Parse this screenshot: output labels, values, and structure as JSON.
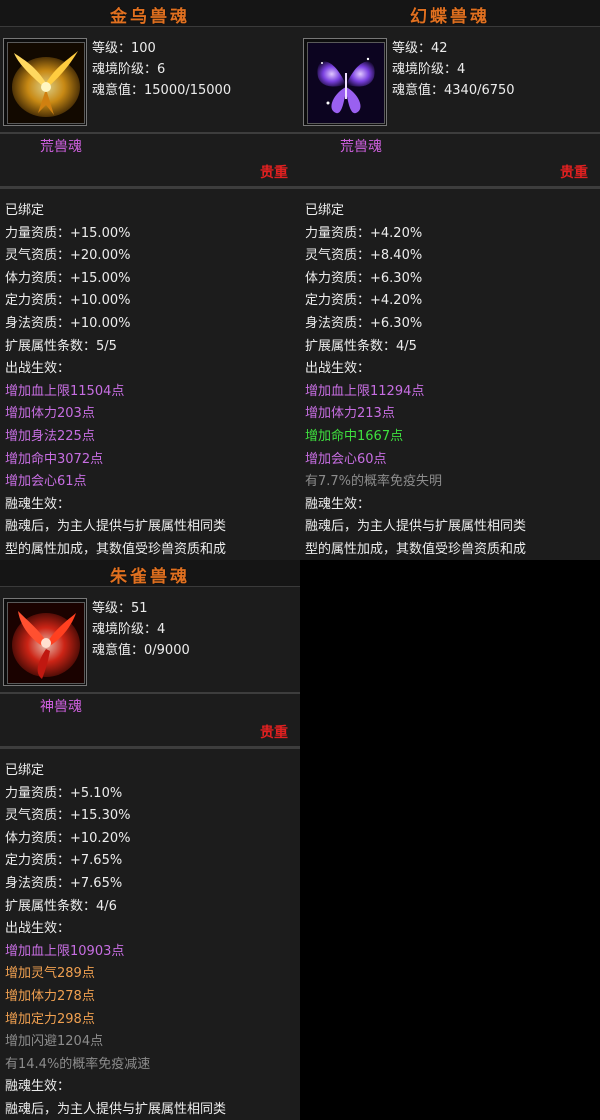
{
  "cards": [
    {
      "title": "金乌兽魂",
      "level_line": "等级：100",
      "realm_line": "魂境阶级：6",
      "soul_line": "魂意值：15000/15000",
      "grade": "荒兽魂",
      "rank": "贵重",
      "bound": "已绑定",
      "attrs": [
        "力量资质：+15.00%",
        "灵气资质：+20.00%",
        "体力资质：+15.00%",
        "定力资质：+10.00%",
        "身法资质：+10.00%"
      ],
      "ext": "扩展属性条数：5/5",
      "battle_label": "出战生效：",
      "effects": [
        "增加血上限11504点",
        "增加体力203点",
        "增加身法225点",
        "增加命中3072点",
        "增加会心61点"
      ],
      "fusion_label": "融魂生效：",
      "fusion_text": [
        "融魂后，为主人提供与扩展属性相同类",
        "型的属性加成，其数值受珍兽资质和成"
      ]
    },
    {
      "title": "幻蝶兽魂",
      "level_line": "等级：42",
      "realm_line": "魂境阶级：4",
      "soul_line": "魂意值：4340/6750",
      "grade": "荒兽魂",
      "rank": "贵重",
      "bound": "已绑定",
      "attrs": [
        "力量资质：+4.20%",
        "灵气资质：+8.40%",
        "体力资质：+6.30%",
        "定力资质：+4.20%",
        "身法资质：+6.30%"
      ],
      "ext": "扩展属性条数：4/5",
      "battle_label": "出战生效：",
      "effects": [
        "增加血上限11294点",
        "增加体力213点",
        "增加命中1667点",
        "增加会心60点",
        "有7.7%的概率免疫失明"
      ],
      "fusion_label": "融魂生效：",
      "fusion_text": [
        "融魂后，为主人提供与扩展属性相同类",
        "型的属性加成，其数值受珍兽资质和成"
      ]
    },
    {
      "title": "朱雀兽魂",
      "level_line": "等级：51",
      "realm_line": "魂境阶级：4",
      "soul_line": "魂意值：0/9000",
      "grade": "神兽魂",
      "rank": "贵重",
      "bound": "已绑定",
      "attrs": [
        "力量资质：+5.10%",
        "灵气资质：+15.30%",
        "体力资质：+10.20%",
        "定力资质：+7.65%",
        "身法资质：+7.65%"
      ],
      "ext": "扩展属性条数：4/6",
      "battle_label": "出战生效：",
      "effects": [
        "增加血上限10903点",
        "增加灵气289点",
        "增加体力278点",
        "增加定力298点",
        "增加闪避1204点",
        "有14.4%的概率免疫减速"
      ],
      "fusion_label": "融魂生效：",
      "fusion_text": [
        "融魂后，为主人提供与扩展属性相同类"
      ]
    }
  ],
  "colors": {
    "title": "#e07020",
    "grade": "#d060e0",
    "rank": "#e02020",
    "effect_purple": "#c76ee2",
    "effect_orange": "#f0a050",
    "effect_green": "#3ee03e",
    "effect_gray": "#8c8c8c"
  },
  "icons": [
    "golden-crow-icon",
    "butterfly-icon",
    "vermilion-bird-icon"
  ]
}
